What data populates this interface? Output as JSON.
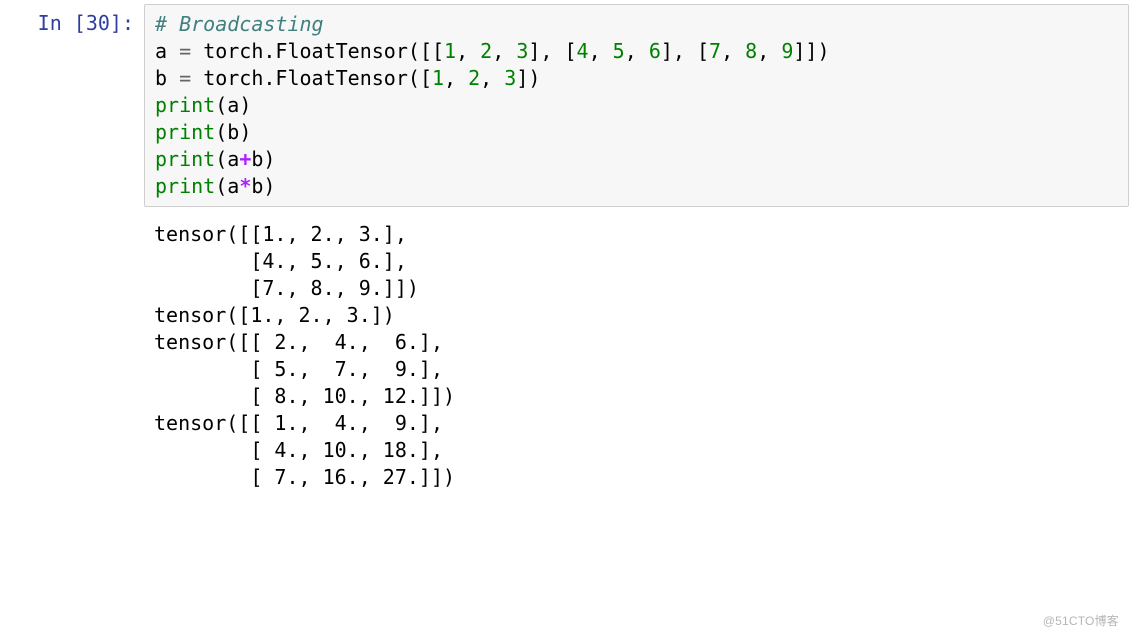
{
  "prompt": {
    "label": "In [30]:"
  },
  "code": {
    "comment": "# Broadcasting",
    "line2": {
      "a": "a",
      "eq": "=",
      "torchCall": "torch.FloatTensor",
      "lp": "(",
      "lb1": "[[",
      "n1": "1",
      "c": ", ",
      "n2": "2",
      "n3": "3",
      "mid1": "], [",
      "n4": "4",
      "n5": "5",
      "n6": "6",
      "mid2": "], [",
      "n7": "7",
      "n8": "8",
      "n9": "9",
      "rb": "]]",
      "rp": ")"
    },
    "line3": {
      "b": "b",
      "eq": "=",
      "torchCall": "torch.FloatTensor",
      "lp": "(",
      "lb": "[",
      "n1": "1",
      "c": ", ",
      "n2": "2",
      "n3": "3",
      "rb": "]",
      "rp": ")"
    },
    "print": "print",
    "argA": "a",
    "argB": "b",
    "plus": "+",
    "star": "*",
    "lp": "(",
    "rp": ")"
  },
  "output": "tensor([[1., 2., 3.],\n        [4., 5., 6.],\n        [7., 8., 9.]])\ntensor([1., 2., 3.])\ntensor([[ 2.,  4.,  6.],\n        [ 5.,  7.,  9.],\n        [ 8., 10., 12.]])\ntensor([[ 1.,  4.,  9.],\n        [ 4., 10., 18.],\n        [ 7., 16., 27.]])",
  "watermark": "@51CTO博客"
}
